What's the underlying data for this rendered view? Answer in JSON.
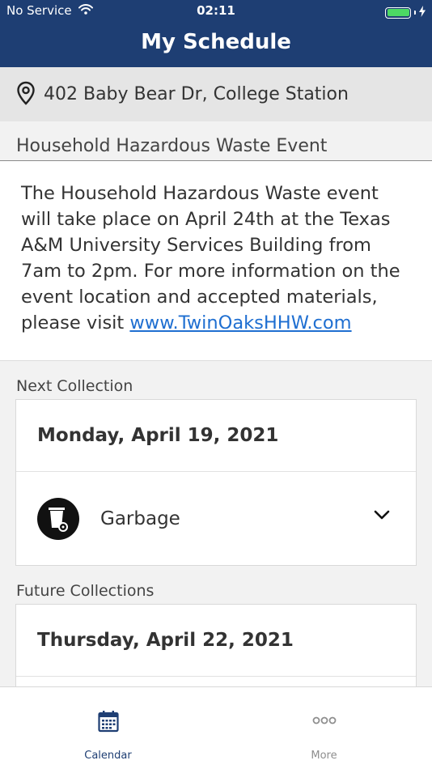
{
  "status_bar": {
    "carrier": "No Service",
    "time": "02:11",
    "battery_color": "#4cd964"
  },
  "nav": {
    "title": "My Schedule",
    "background": "#1e3e73"
  },
  "address": {
    "icon": "location-pin-icon",
    "text": "402 Baby Bear Dr, College Station"
  },
  "notice": {
    "title": "Household Hazardous Waste Event",
    "body": "The Household Hazardous Waste event will take place on April 24th at the Texas A&M University Services Building from 7am to 2pm. For more information on the event location and accepted materials, please visit ",
    "link_text": "www.TwinOaksHHW.com",
    "link_color": "#1f6fd1"
  },
  "next_collection": {
    "label": "Next Collection",
    "date": "Monday, April 19, 2021",
    "items": [
      {
        "icon": "garbage-bin-icon",
        "label": "Garbage"
      }
    ]
  },
  "future_collections": {
    "label": "Future Collections",
    "date": "Thursday, April 22, 2021"
  },
  "tabbar": {
    "tabs": [
      {
        "label": "Calendar",
        "icon": "calendar-icon",
        "active": true,
        "color": "#1e3e73"
      },
      {
        "label": "More",
        "icon": "more-dots-icon",
        "active": false,
        "color": "#8e8e8e"
      }
    ]
  }
}
